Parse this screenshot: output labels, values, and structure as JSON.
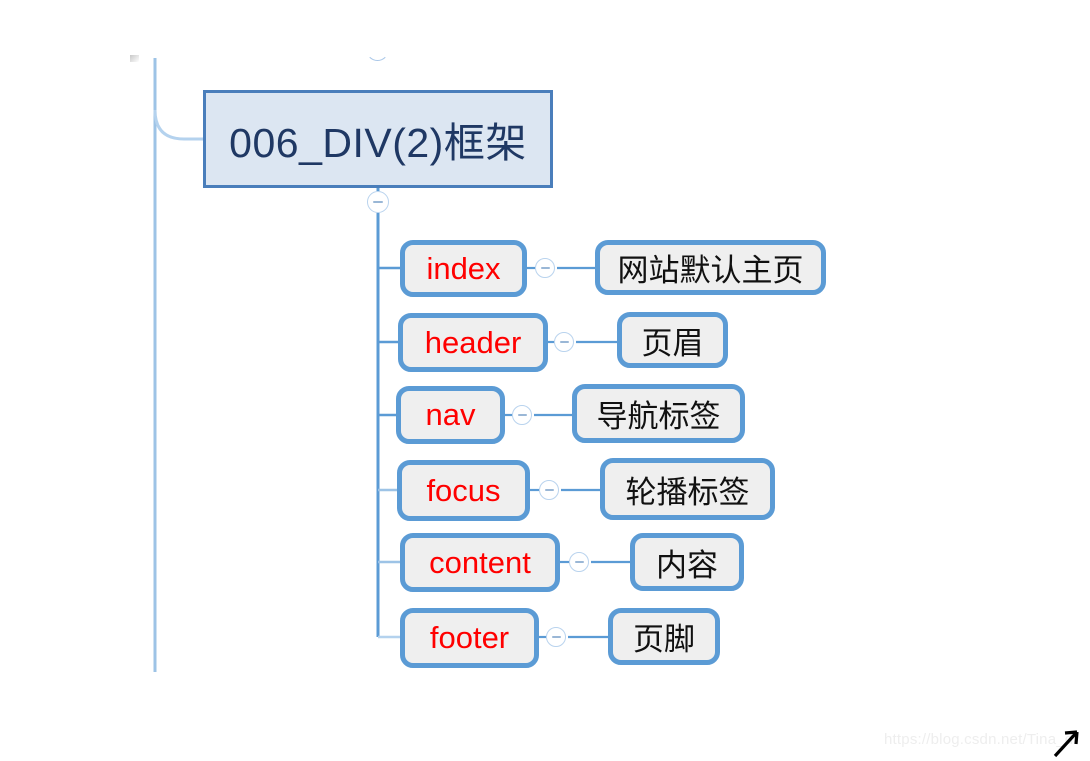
{
  "diagram": {
    "type": "mind-map",
    "root": {
      "label": "006_DIV(2)框架",
      "fill": "#dce6f2",
      "border": "#4a7ebb",
      "text_color": "#1f3864"
    },
    "node_style": {
      "fill": "#efefef",
      "border": "#5b9bd5",
      "en_text_color": "#ff0000",
      "cn_text_color": "#111111"
    },
    "children": [
      {
        "tag": "index",
        "description": "网站默认主页"
      },
      {
        "tag": "header",
        "description": "页眉"
      },
      {
        "tag": "nav",
        "description": "导航标签"
      },
      {
        "tag": "focus",
        "description": "轮播标签"
      },
      {
        "tag": "content",
        "description": "内容"
      },
      {
        "tag": "footer",
        "description": "页脚"
      }
    ]
  },
  "toggles": {
    "root_collapse": "−",
    "branch_collapse": "−"
  },
  "watermark": {
    "text": "https://blog.csdn.net/Tina_dl"
  }
}
